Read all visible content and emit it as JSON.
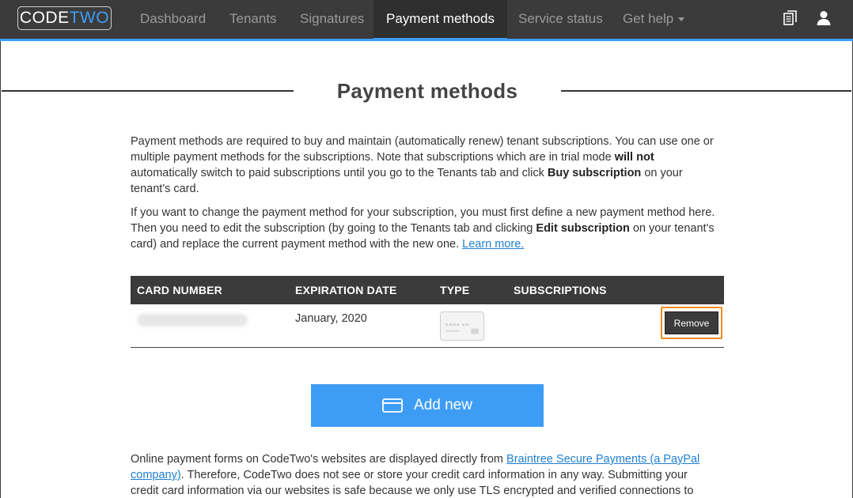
{
  "brand": {
    "logo_code": "CODE",
    "logo_two": "TWO"
  },
  "nav": {
    "items": [
      {
        "label": "Dashboard"
      },
      {
        "label": "Tenants"
      },
      {
        "label": "Signatures"
      },
      {
        "label": "Payment methods",
        "active": true
      },
      {
        "label": "Service status"
      },
      {
        "label": "Get help"
      }
    ],
    "icons": [
      "documents-icon",
      "user-icon"
    ]
  },
  "page": {
    "title": "Payment methods",
    "intro_1a": "Payment methods are required to buy and maintain (automatically renew) tenant subscriptions. You can use one or multiple payment methods for the subscriptions. Note that subscriptions which are in trial mode ",
    "intro_1b": "will not",
    "intro_1c": " automatically switch to paid subscriptions until you go to the Tenants tab and click ",
    "intro_1d": "Buy subscription",
    "intro_1e": " on your tenant's card.",
    "intro_2a": "If you want to change the payment method for your subscription, you must first define a new payment method here. Then you need to edit the subscription (by going to the Tenants tab and clicking ",
    "intro_2b": "Edit subscription",
    "intro_2c": " on your tenant's card) and replace the current payment method with the new one. ",
    "intro_2_link": "Learn more."
  },
  "table": {
    "headers": [
      "CARD NUMBER",
      "EXPIRATION DATE",
      "TYPE",
      "SUBSCRIPTIONS"
    ],
    "rows": [
      {
        "expiration": "January, 2020",
        "type_icon": "credit-card-icon",
        "remove_label": "Remove"
      }
    ]
  },
  "add_new": {
    "label": "Add new"
  },
  "footer": {
    "text_a": "Online payment forms on CodeTwo's websites are displayed directly from ",
    "link": "Braintree Secure Payments (a PayPal company)",
    "text_b": ". Therefore, CodeTwo does not see or store your credit card information in any way. Submitting your credit card information via our websites is safe because we only use TLS encrypted and verified connections to"
  },
  "colors": {
    "accent": "#3d9df5",
    "nav_bg": "#3b3b3b",
    "highlight": "#f08a1c"
  }
}
